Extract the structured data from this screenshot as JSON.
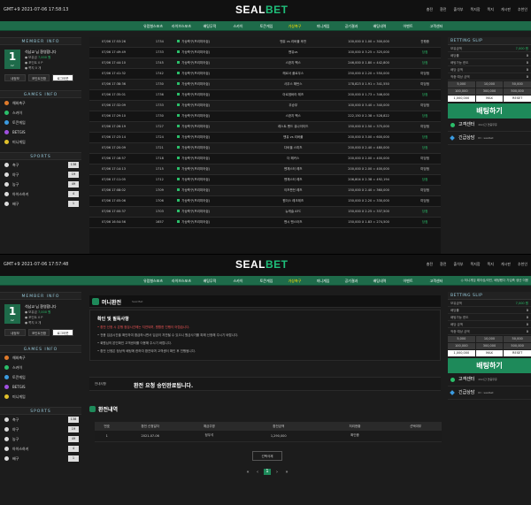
{
  "s1": {
    "clock": "GMT+9 2021-07-06 17:58:13",
    "logo_a": "SEAL",
    "logo_b": "BET",
    "top_links": [
      "충전",
      "환전",
      "출석부",
      "쪽지함",
      "쪽지",
      "게시판",
      "추천인"
    ],
    "nav": [
      "유럽형스포츠",
      "라이브스포츠",
      "배팅무적",
      "스카이",
      "토큰게임",
      "가상축구",
      "미니게임",
      "공기결과",
      "배팅내역",
      "이벤트",
      "고객센터"
    ],
    "nav_active": "가상축구",
    "notice": "◎ 터니게임 레이싱/라인, 배팅했다 가입축 생산 이용",
    "bet_rows": [
      [
        "07/06 17:53:26",
        "1734",
        "가상축구(프리미어쉽)",
        "맨유 vs 리버풀 후반",
        "100,000 X 1.00 = 300,000",
        "진행중"
      ],
      [
        "07/06 17:49:49",
        "1733",
        "가상축구(프리미어쉽)",
        "맨유vs",
        "100,000 X 3.25 = 325,000",
        "당첨"
      ],
      [
        "07/06 17:44:10",
        "1745",
        "가상축구(프리미어쉽)",
        "스완지 팩스",
        "246,000 X 1.80 = 442,800",
        "당첨"
      ],
      [
        "07/06 17:41:32",
        "1742",
        "가상축구(프리미어쉽)",
        "헤르서 플로우스",
        "250,000 X 2.20 = 550,000",
        "미당첨"
      ],
      [
        "07/06 17:38:36",
        "1730",
        "가상축구(프리미어쉽)",
        "사우스 해턴스",
        "178,823 X 1.91 = 341,550",
        "미당첨"
      ],
      [
        "07/06 17:35:01",
        "1736",
        "가상축구(프리미어쉽)",
        "아르셈바라 레즈",
        "200,000 X 1.73 = 346,000",
        "당첨"
      ],
      [
        "07/06 17:32:09",
        "1733",
        "가상축구(프리미어쉽)",
        "무승부",
        "100,000 X 3.40 = 340,000",
        "미당첨"
      ],
      [
        "07/06 17:29:10",
        "1730",
        "가상축구(프리미어쉽)",
        "스완지 팩스",
        "222,150 X 2.38 = 528,822",
        "당첨"
      ],
      [
        "07/06 17:26:19",
        "1727",
        "가상축구(프리미어쉽)",
        "레스트 벤드 유나이티드",
        "150,000 X 2.50 = 375,000",
        "미당첨"
      ],
      [
        "07/06 17:23:14",
        "1724",
        "가상축구(프리미어쉽)",
        "맨유 vs 리버풀",
        "200,000 X 3.00 = 600,000",
        "당첨"
      ],
      [
        "07/06 17:20:09",
        "1721",
        "가상축구(프리미어쉽)",
        "다비올 스미츠",
        "200,000 X 2.40 = 480,000",
        "당첨"
      ],
      [
        "07/06 17:16:57",
        "1718",
        "가상축구(프리미어쉽)",
        "더 해커스",
        "200,000 X 2.00 = 400,000",
        "미당첨"
      ],
      [
        "07/06 17:14:13",
        "1715",
        "가상축구(프리미어쉽)",
        "벤체스터 레즈",
        "200,000 X 2.00 = 400,000",
        "미당첨"
      ],
      [
        "07/06 17:11:05",
        "1712",
        "가상축구(프리미어쉽)",
        "벤체스터 레즈",
        "206,804 X 2.38 = 492,194",
        "당첨"
      ],
      [
        "07/06 17:08:02",
        "1709",
        "가상축구(프리미어쉽)",
        "이즈판던 레즈",
        "150,000 X 2.40 = 360,000",
        "미당첨"
      ],
      [
        "07/06 17:05:06",
        "1706",
        "가상축구(프리미어쉽)",
        "원더스 레크레즈",
        "150,000 X 2.20 = 330,000",
        "미당첨"
      ],
      [
        "07/06 17:00:37",
        "1703",
        "가상축구(프리미어쉽)",
        "뉴캐슬 AFC",
        "150,000 X 2.25 = 337,500",
        "당첨"
      ],
      [
        "07/06 16:54:56",
        "1657",
        "가상축구(프리미어쉽)",
        "맨시 밴스터즈",
        "150,000 X 1.83 = 274,500",
        "당첨"
      ]
    ]
  },
  "s2": {
    "clock": "GMT+9 2021-07-06 17:57:48",
    "page_title": "머니환전",
    "page_sub": "Seal Bet",
    "info_title": "확인 및 필독사항",
    "info_lines": [
      "환전 신청 시 은행 점검시간에는 지연되며, 원활한 진행이 어렵습니다.",
      "전용 입금시간을 확인하여 환급하시면서 입금이 지연될 수 있으니 원금사기를 피해 신청해 주시기 바랍니다.",
      "회원님의 본인확인 고객센터를 이용해 주시기 바랍니다.",
      "환전 신청은 정상적 배팅에 한하여 환전되며 고객센터 확인 후 진행됩니다."
    ],
    "msg_key": "안내사항",
    "msg": "환전 요청 승인완료됩니다.",
    "hist_title": "환전내역",
    "hist_headers": [
      "번호",
      "환전 신청일자",
      "예금주명",
      "환전금액",
      "처리현황",
      "선택여부"
    ],
    "hist_row": [
      "1",
      "2021-07-06",
      "정우석",
      "1,290,000",
      "확인중",
      ""
    ],
    "delete_label": "선택삭제",
    "pager": [
      "«",
      "‹",
      "1",
      "›",
      "»"
    ]
  },
  "member": {
    "header": "MEMBER INFO",
    "level": "1",
    "level_tag": "LV",
    "name": "석남교 님 환영합니다",
    "rows": [
      [
        "● 보유금",
        "7,000 원"
      ],
      [
        "● 포인트",
        "0 P"
      ],
      [
        "● 쪽지",
        "0 개"
      ]
    ],
    "buttons": [
      "내정보",
      "포인트전환",
      "로그아웃"
    ]
  },
  "games": {
    "header": "GAMES INFO",
    "items": [
      {
        "label": "해외축구",
        "color": "#e07a2b"
      },
      {
        "label": "스카이",
        "color": "#2bbf6a"
      },
      {
        "label": "토큰게임",
        "color": "#3b9be0"
      },
      {
        "label": "BETGIS",
        "color": "#a050e0"
      },
      {
        "label": "미니게임",
        "color": "#e0c02b"
      }
    ]
  },
  "sports": {
    "header": "SPORTS",
    "items": [
      {
        "label": "축구",
        "count": "138"
      },
      {
        "label": "야구",
        "count": "19"
      },
      {
        "label": "농구",
        "count": "49"
      },
      {
        "label": "아이스하키",
        "count": "4"
      },
      {
        "label": "배구",
        "count": "1"
      }
    ]
  },
  "slip": {
    "header": "BETTING SLIP",
    "rows": [
      {
        "k": "보유금액",
        "v": "7,000 원",
        "green": true
      },
      {
        "k": "배당률",
        "v": "0",
        "green": false
      },
      {
        "k": "배팅가능 한도",
        "v": "0",
        "green": false
      },
      {
        "k": "배당 금액",
        "v": "0",
        "green": false
      },
      {
        "k": "적중 예상 금액",
        "v": "0",
        "green": false
      }
    ],
    "amounts": [
      "5,000",
      "10,000",
      "50,000",
      "100,000",
      "300,000",
      "500,000",
      "1,000,000",
      "MAX",
      "RESET"
    ],
    "bet_button": "배팅하기",
    "support": [
      {
        "label": "고객센터",
        "sub": "24시간 연중무휴"
      },
      {
        "label": "긴급상담",
        "sub": "ID : sealbet"
      }
    ]
  }
}
